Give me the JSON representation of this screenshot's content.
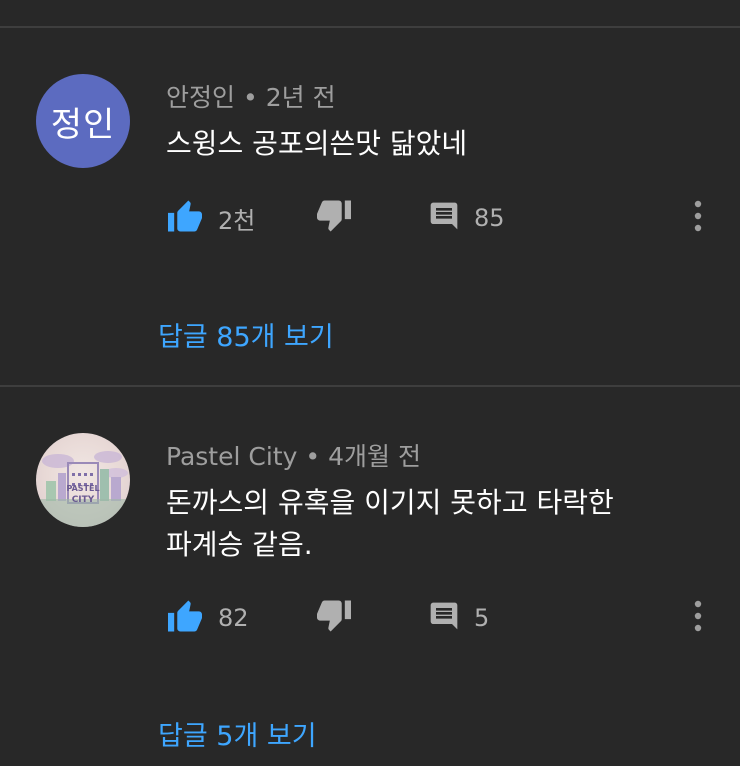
{
  "comments": [
    {
      "avatar_text": "정인",
      "author": "안정인",
      "separator": "•",
      "time": "2년 전",
      "text": "스윙스 공포의쓴맛 닮았네",
      "likes": "2천",
      "reply_count": "85",
      "view_replies": "답글 85개 보기"
    },
    {
      "avatar_text": "PASTEL CITY",
      "author": "Pastel City",
      "separator": "•",
      "time": "4개월 전",
      "text": "돈까스의 유혹을 이기지 못하고 타락한 파계승 같음.",
      "likes": "82",
      "reply_count": "5",
      "view_replies": "답글 5개 보기"
    }
  ],
  "colors": {
    "background": "#282828",
    "like_active": "#3ea6ff",
    "link": "#3ea6ff",
    "muted": "#9e9e9e",
    "avatar_bg": "#5c6bc0"
  },
  "icons": {
    "like": "thumbs-up-icon",
    "dislike": "thumbs-down-icon",
    "reply": "comment-icon",
    "more": "more-vert-icon"
  }
}
